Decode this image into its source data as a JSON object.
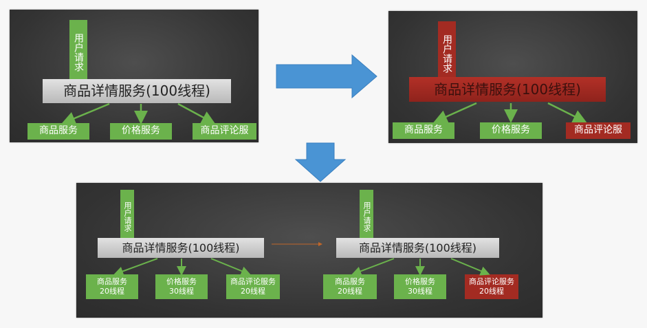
{
  "colors": {
    "green": "#6bb24c",
    "red": "#a32b22",
    "gray": "#cfcfcf",
    "blue_arrow": "#4a94d4",
    "panel": "#3a3a3a"
  },
  "diagrams": {
    "top_left": {
      "user_request": "用户请求",
      "main_service": "商品详情服务(100线程)",
      "services": [
        "商品服务",
        "价格服务",
        "商品评论服"
      ]
    },
    "top_right": {
      "user_request": "用户请求",
      "main_service": "商品详情服务(100线程)",
      "services": [
        "商品服务",
        "价格服务",
        "商品评论服"
      ]
    },
    "bottom_left": {
      "user_request": "用户请求",
      "main_service": "商品详情服务(100线程)",
      "services": [
        {
          "name": "商品服务",
          "threads": "20线程"
        },
        {
          "name": "价格服务",
          "threads": "30线程"
        },
        {
          "name": "商品评论服务",
          "threads": "20线程"
        }
      ]
    },
    "bottom_right": {
      "user_request": "用户请求",
      "main_service": "商品详情服务(100线程)",
      "services": [
        {
          "name": "商品服务",
          "threads": "20线程"
        },
        {
          "name": "价格服务",
          "threads": "30线程"
        },
        {
          "name": "商品评论服务",
          "threads": "20线程"
        }
      ]
    }
  }
}
